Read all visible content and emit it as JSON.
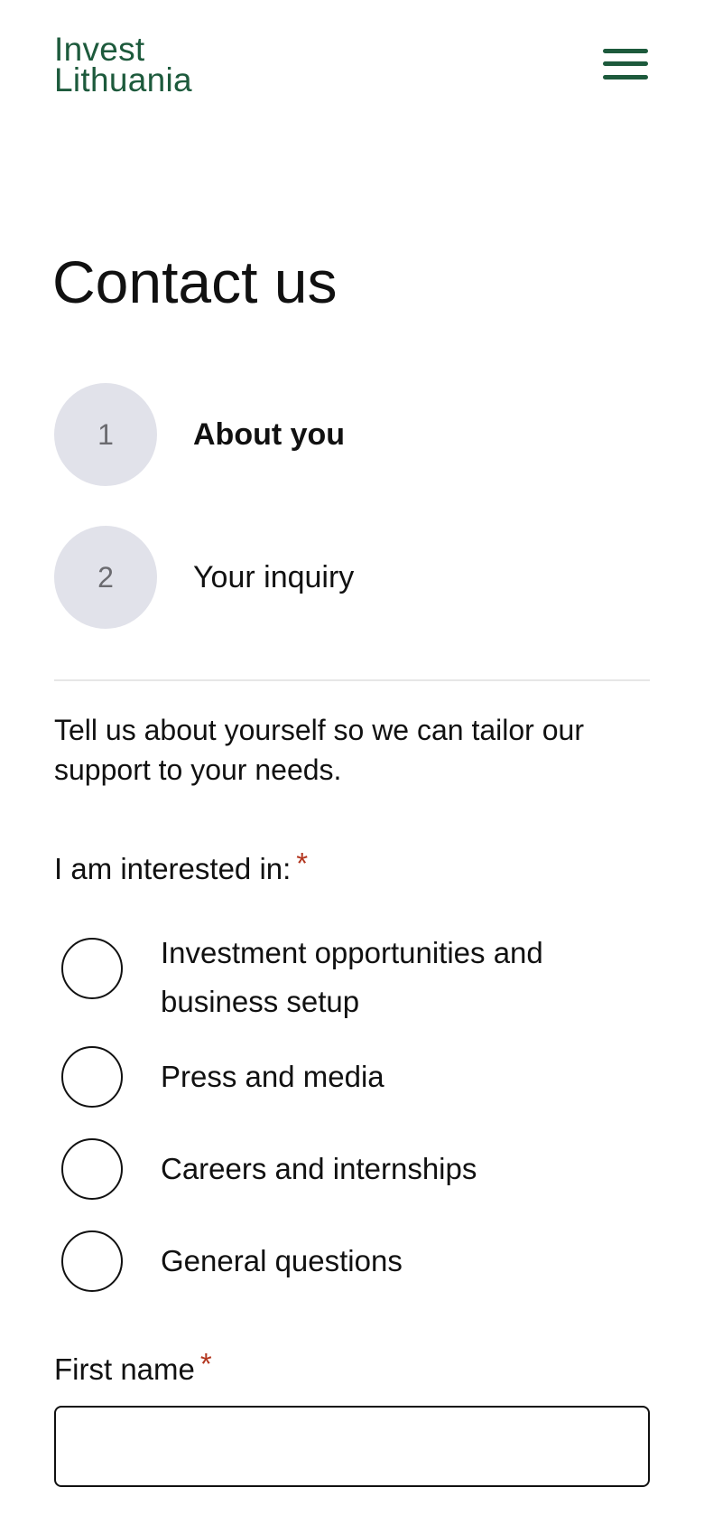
{
  "header": {
    "logo_line1": "Invest",
    "logo_line2": "Lithuania",
    "menu_icon": "hamburger-menu-icon",
    "brand_color": "#1d5a3c"
  },
  "page": {
    "title": "Contact us"
  },
  "steps": [
    {
      "number": "1",
      "label": "About you",
      "active": true
    },
    {
      "number": "2",
      "label": "Your inquiry",
      "active": false
    }
  ],
  "intro": "Tell us about yourself so we can tailor our support to your needs.",
  "interest": {
    "label": "I am interested in:",
    "required_mark": "*",
    "options": [
      {
        "label": "Investment opportunities and business setup",
        "selected": false
      },
      {
        "label": "Press and media",
        "selected": false
      },
      {
        "label": "Careers and internships",
        "selected": false
      },
      {
        "label": "General questions",
        "selected": false
      }
    ]
  },
  "first_name": {
    "label": "First name",
    "required_mark": "*",
    "value": ""
  },
  "colors": {
    "required": "#b3361f",
    "step_circle": "#e1e2ea"
  }
}
